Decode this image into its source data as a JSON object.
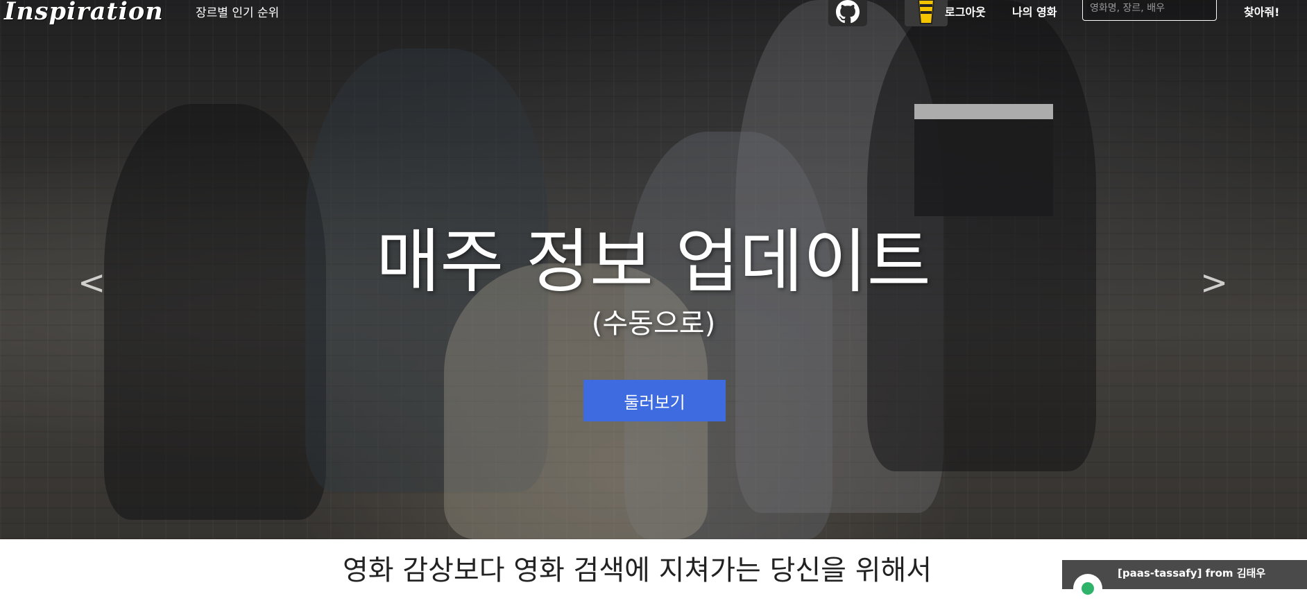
{
  "nav": {
    "logo": "Inspiration",
    "genre_ranking": "장르별 인기 순위",
    "github_icon": "github-icon",
    "cup_icon": "beer-cup-icon",
    "logout": "로그아웃",
    "my_movies": "나의 영화",
    "search_placeholder": "영화명, 장르, 배우",
    "find": "찾아줘!"
  },
  "carousel": {
    "prev_label": "<",
    "next_label": ">",
    "title": "매주 정보 업데이트",
    "subtitle": "(수동으로)",
    "button": "둘러보기",
    "button_color": "#3e6be0"
  },
  "main": {
    "tagline": "영화 감상보다 영화 검색에 지쳐가는 당신을 위해서"
  },
  "notification": {
    "text": "[paas-tassafy] from 김태우"
  }
}
